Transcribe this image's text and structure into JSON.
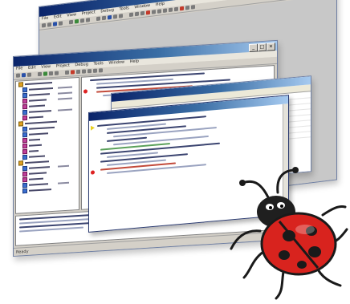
{
  "windows": {
    "back": {
      "title": "",
      "menu": [
        "File",
        "Edit",
        "View",
        "Project",
        "Debug",
        "Tools",
        "Window",
        "Help"
      ]
    },
    "main": {
      "title": "",
      "menu": [
        "File",
        "Edit",
        "View",
        "Project",
        "Debug",
        "Tools",
        "Window",
        "Help"
      ],
      "status": "Ready"
    },
    "grid": {
      "title": ""
    },
    "popup": {
      "title": ""
    }
  },
  "window_controls": {
    "min": "_",
    "max": "□",
    "close": "×"
  },
  "colors": {
    "title_start": "#0a246a",
    "title_end": "#a6caf0",
    "chrome": "#d4d0c8",
    "breakpoint": "#dd2222",
    "bug_shell": "#d8231e"
  },
  "icons": [
    "ladybug-icon",
    "breakpoint-icon",
    "current-line-arrow-icon",
    "class-icon",
    "function-icon",
    "folder-icon"
  ]
}
